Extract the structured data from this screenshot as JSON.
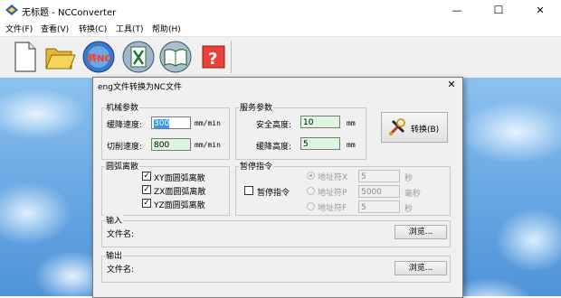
{
  "window": {
    "title": "无标题 - NCConverter",
    "minimize": "—",
    "maximize": "☐",
    "close": "✕"
  },
  "menu": [
    "文件(F)",
    "查看(V)",
    "转换(C)",
    "工具(T)",
    "帮助(H)"
  ],
  "toolbar": {
    "items": [
      "new-file-icon",
      "open-folder-icon",
      "convert-nc-icon",
      "excel-icon",
      "book-icon",
      "help-icon"
    ],
    "convert_icon_text": "转NC",
    "help_icon_text": "?"
  },
  "dialog": {
    "title": "eng文件转换为NC文件",
    "close": "✕",
    "machine_params": {
      "label": "机械参数",
      "feed_speed_label": "缓降速度:",
      "feed_speed_value": "300",
      "cut_speed_label": "切削速度:",
      "cut_speed_value": "800",
      "unit": "mm/min"
    },
    "service_params": {
      "label": "服务参数",
      "safe_height_label": "安全高度:",
      "safe_height_value": "10",
      "slow_height_label": "缓降高度:",
      "slow_height_value": "5",
      "unit": "mm"
    },
    "convert_button": "转换(B)",
    "arc_discrete": {
      "label": "圆弧离散",
      "xy_label": "XY面圆弧离散",
      "zx_label": "ZX面圆弧离散",
      "yz_label": "YZ面圆弧离散",
      "xy_checked": "✓",
      "zx_checked": "✓",
      "yz_checked": "✓"
    },
    "pause": {
      "label": "暂停指令",
      "enable_label": "暂停指令",
      "addr_x_label": "地址符X",
      "addr_x_value": "5",
      "addr_x_unit": "秒",
      "addr_p_label": "地址符P",
      "addr_p_value": "5000",
      "addr_p_unit": "毫秒",
      "addr_f_label": "地址符F",
      "addr_f_value": "5",
      "addr_f_unit": "秒"
    },
    "input": {
      "label": "输入",
      "file_label": "文件名:",
      "browse": "浏览..."
    },
    "output": {
      "label": "输出",
      "file_label": "文件名:",
      "browse": "浏览..."
    }
  },
  "colors": {
    "selection": "#3399ff",
    "field_green": "#ddf5dd",
    "desktop_blue": "#6aa9e3"
  }
}
